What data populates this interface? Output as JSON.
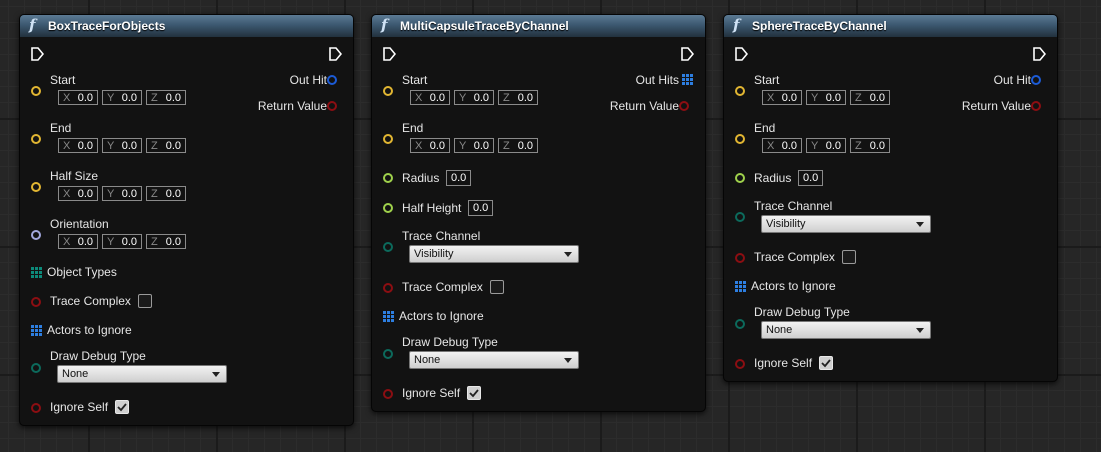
{
  "nodes": [
    {
      "title": "BoxTraceForObjects",
      "outputs": [
        "Out Hit",
        "Return Value"
      ],
      "inputs": {
        "start": {
          "label": "Start",
          "x": "0.0",
          "y": "0.0",
          "z": "0.0"
        },
        "end": {
          "label": "End",
          "x": "0.0",
          "y": "0.0",
          "z": "0.0"
        },
        "half_size": {
          "label": "Half Size",
          "x": "0.0",
          "y": "0.0",
          "z": "0.0"
        },
        "orientation": {
          "label": "Orientation",
          "x": "0.0",
          "y": "0.0",
          "z": "0.0"
        },
        "object_types": "Object Types",
        "trace_complex": "Trace Complex",
        "actors_to_ignore": "Actors to Ignore",
        "draw_debug_type": {
          "label": "Draw Debug Type",
          "value": "None"
        },
        "ignore_self": "Ignore Self"
      }
    },
    {
      "title": "MultiCapsuleTraceByChannel",
      "outputs": [
        "Out Hits",
        "Return Value"
      ],
      "inputs": {
        "start": {
          "label": "Start",
          "x": "0.0",
          "y": "0.0",
          "z": "0.0"
        },
        "end": {
          "label": "End",
          "x": "0.0",
          "y": "0.0",
          "z": "0.0"
        },
        "radius": {
          "label": "Radius",
          "value": "0.0"
        },
        "half_height": {
          "label": "Half Height",
          "value": "0.0"
        },
        "trace_channel": {
          "label": "Trace Channel",
          "value": "Visibility"
        },
        "trace_complex": "Trace Complex",
        "actors_to_ignore": "Actors to Ignore",
        "draw_debug_type": {
          "label": "Draw Debug Type",
          "value": "None"
        },
        "ignore_self": "Ignore Self"
      }
    },
    {
      "title": "SphereTraceByChannel",
      "outputs": [
        "Out Hit",
        "Return Value"
      ],
      "inputs": {
        "start": {
          "label": "Start",
          "x": "0.0",
          "y": "0.0",
          "z": "0.0"
        },
        "end": {
          "label": "End",
          "x": "0.0",
          "y": "0.0",
          "z": "0.0"
        },
        "radius": {
          "label": "Radius",
          "value": "0.0"
        },
        "trace_channel": {
          "label": "Trace Channel",
          "value": "Visibility"
        },
        "trace_complex": "Trace Complex",
        "actors_to_ignore": "Actors to Ignore",
        "draw_debug_type": {
          "label": "Draw Debug Type",
          "value": "None"
        },
        "ignore_self": "Ignore Self"
      }
    }
  ],
  "axis_labels": {
    "x": "X",
    "y": "Y",
    "z": "Z"
  },
  "function_glyph": "f",
  "colors": {
    "vector_pin": "#e2b632",
    "rotator_pin": "#a3a8de",
    "float_pin": "#9fd14c",
    "enum_pin": "#0c6a5c",
    "bool_pin": "#8c0e12",
    "hit_pin": "#1c5bd6",
    "header": "#3c5870"
  }
}
